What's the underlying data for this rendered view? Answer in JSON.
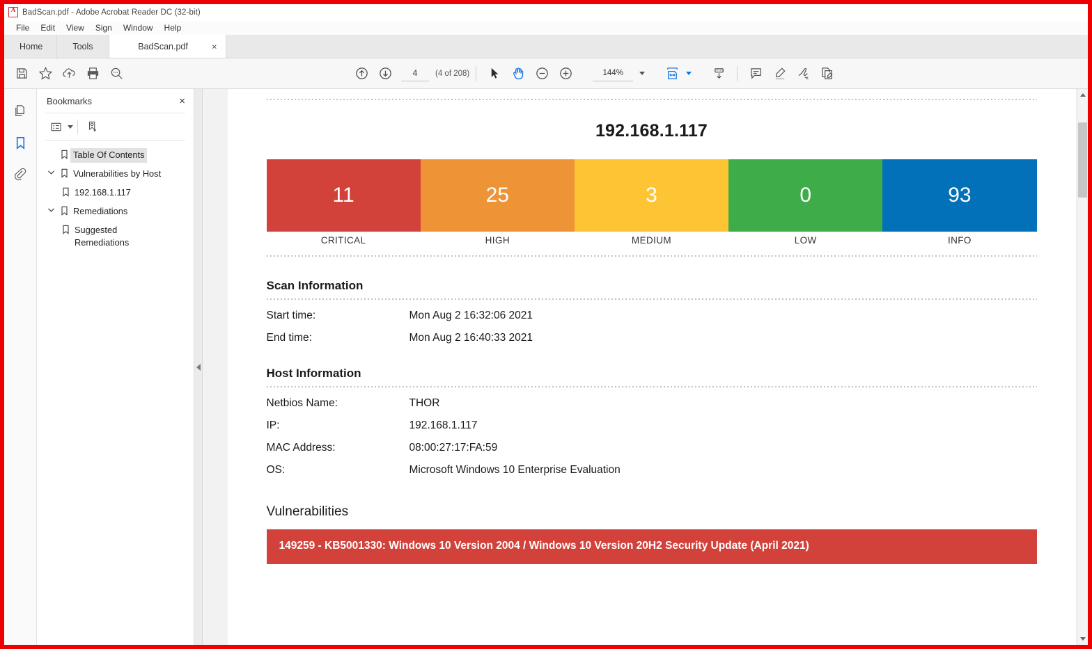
{
  "window": {
    "title": "BadScan.pdf - Adobe Acrobat Reader DC (32-bit)",
    "app_icon": "acrobat-logo"
  },
  "menubar": {
    "items": [
      "File",
      "Edit",
      "View",
      "Sign",
      "Window",
      "Help"
    ]
  },
  "tabs": {
    "home_label": "Home",
    "tools_label": "Tools",
    "document_label": "BadScan.pdf",
    "close_glyph": "×"
  },
  "toolbar": {
    "left_icons": [
      {
        "name": "save-icon",
        "label": "Save"
      },
      {
        "name": "star-icon",
        "label": "Add to favorites"
      },
      {
        "name": "cloud-upload-icon",
        "label": "Upload"
      },
      {
        "name": "print-icon",
        "label": "Print"
      },
      {
        "name": "find-icon",
        "label": "Find"
      }
    ],
    "page_up_icon": "arrow-up-circle-icon",
    "page_down_icon": "arrow-down-circle-icon",
    "page_number": "4",
    "page_count_text": "(4 of 208)",
    "select_tool_icon": "cursor-arrow-icon",
    "hand_tool_icon": "hand-icon",
    "zoom_out_icon": "zoom-out-icon",
    "zoom_in_icon": "zoom-in-icon",
    "zoom_level": "144%",
    "fit_page_icon": "fit-width-icon",
    "scroll_mode_icon": "page-scroll-icon",
    "right_icons": [
      {
        "name": "comment-icon",
        "label": "Add comment"
      },
      {
        "name": "highlight-icon",
        "label": "Highlight text"
      },
      {
        "name": "sign-icon",
        "label": "Fill & Sign"
      },
      {
        "name": "request-signature-icon",
        "label": "Request signatures"
      }
    ]
  },
  "rail": {
    "items": [
      {
        "name": "page-thumbnails-icon",
        "label": "Page Thumbnails",
        "active": false
      },
      {
        "name": "bookmarks-icon",
        "label": "Bookmarks",
        "active": true
      },
      {
        "name": "attachments-icon",
        "label": "Attachments",
        "active": false
      }
    ]
  },
  "panel": {
    "title": "Bookmarks",
    "close_glyph": "×",
    "options_icon": "bookmark-options-icon",
    "new_bookmark_icon": "new-bookmark-icon",
    "bookmarks": [
      {
        "label": "Table Of Contents",
        "indent": 0,
        "expandable": false,
        "selected": true
      },
      {
        "label": "Vulnerabilities by Host",
        "indent": 0,
        "expandable": true,
        "selected": false
      },
      {
        "label": "192.168.1.117",
        "indent": 1,
        "expandable": false,
        "selected": false
      },
      {
        "label": "Remediations",
        "indent": 0,
        "expandable": true,
        "selected": false
      },
      {
        "label": "Suggested Remediations",
        "indent": 1,
        "expandable": false,
        "selected": false
      }
    ]
  },
  "document": {
    "host_title": "192.168.1.117",
    "scan_information": {
      "heading": "Scan Information",
      "rows": [
        {
          "key": "Start time:",
          "value": "Mon Aug 2 16:32:06 2021"
        },
        {
          "key": "End time:",
          "value": "Mon Aug 2 16:40:33 2021"
        }
      ]
    },
    "host_information": {
      "heading": "Host Information",
      "rows": [
        {
          "key": "Netbios Name:",
          "value": "THOR"
        },
        {
          "key": "IP:",
          "value": "192.168.1.117"
        },
        {
          "key": "MAC Address:",
          "value": "08:00:27:17:FA:59"
        },
        {
          "key": "OS:",
          "value": "Microsoft Windows 10 Enterprise Evaluation"
        }
      ]
    },
    "vulnerabilities": {
      "heading": "Vulnerabilities",
      "items": [
        {
          "title": "149259 - KB5001330: Windows 10 Version 2004 / Windows 10 Version 20H2 Security Update (April 2021)",
          "severity": "CRITICAL",
          "color": "#d2413a"
        }
      ]
    }
  },
  "chart_data": {
    "type": "bar",
    "title": "192.168.1.117",
    "categories": [
      "CRITICAL",
      "HIGH",
      "MEDIUM",
      "LOW",
      "INFO"
    ],
    "values": [
      11,
      25,
      3,
      0,
      93
    ],
    "colors": [
      "#d2413a",
      "#ee9436",
      "#fdc533",
      "#3eac49",
      "#0370ba"
    ],
    "xlabel": "",
    "ylabel": "",
    "layout": "equal-width stacked severity banner",
    "legend": "none",
    "grid": false
  }
}
